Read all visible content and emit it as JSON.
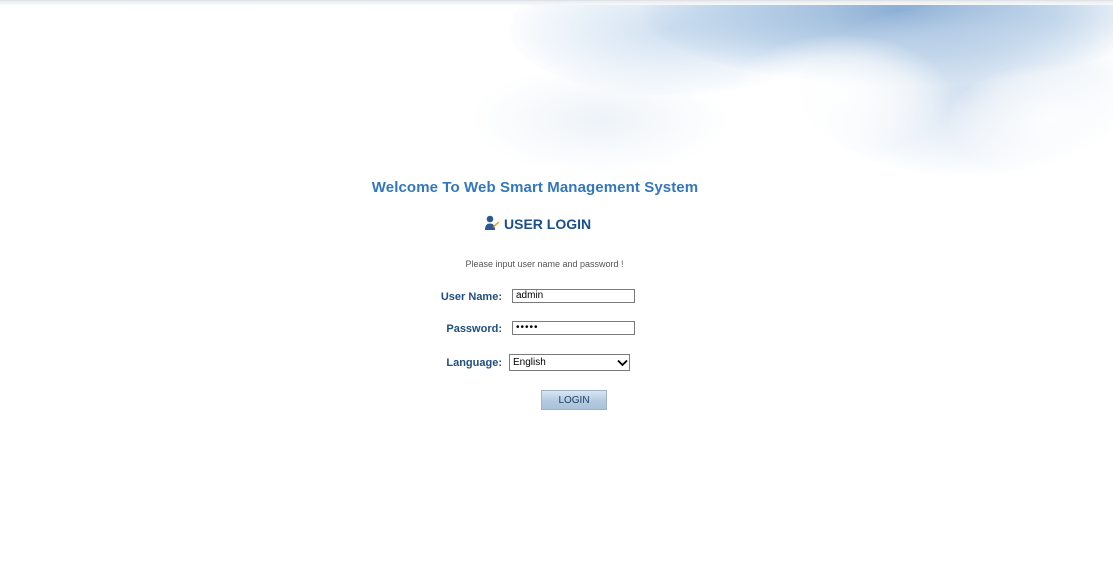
{
  "header": {
    "welcome_text": "Welcome To Web Smart Management System",
    "login_title": "USER LOGIN"
  },
  "form": {
    "hint": "Please input user name and password !",
    "username_label": "User Name:",
    "username_value": "admin",
    "password_label": "Password:",
    "password_value": "•••••",
    "language_label": "Language:",
    "language_value": "English",
    "login_button": "LOGIN"
  },
  "icons": {
    "user": "user-icon",
    "dropdown": "chevron-down-icon"
  },
  "colors": {
    "welcome": "#3377bb",
    "title": "#1b4f8a",
    "label": "#1f4e80",
    "button_bg": "#b7cce2"
  }
}
